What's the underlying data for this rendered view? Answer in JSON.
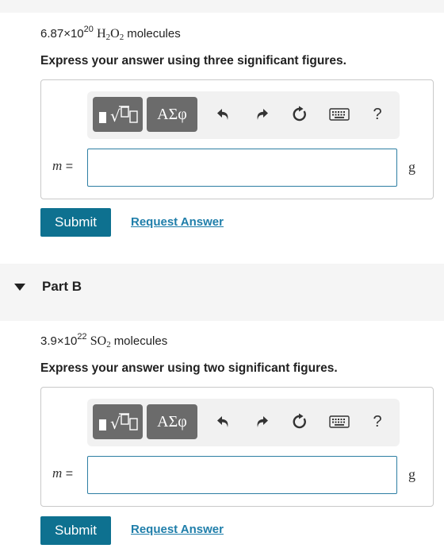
{
  "part_a": {
    "coefficient": "6.87",
    "times": "×",
    "base": "10",
    "exponent": "20",
    "formula": [
      {
        "text": "H",
        "sub": "2"
      },
      {
        "text": "O",
        "sub": "2"
      }
    ],
    "unit_word": "molecules",
    "instruction": "Express your answer using three significant figures.",
    "variable": "m",
    "equals": "=",
    "answer_value": "",
    "unit": "g",
    "submit_label": "Submit",
    "request_label": "Request Answer"
  },
  "part_b_header": {
    "title": "Part B"
  },
  "part_b": {
    "coefficient": "3.9",
    "times": "×",
    "base": "10",
    "exponent": "22",
    "formula": [
      {
        "text": "SO",
        "sub": "2"
      }
    ],
    "unit_word": "molecules",
    "instruction": "Express your answer using two significant figures.",
    "variable": "m",
    "equals": "=",
    "answer_value": "",
    "unit": "g",
    "submit_label": "Submit",
    "request_label": "Request Answer"
  },
  "toolbar": {
    "greek_label": "ΑΣφ",
    "help_label": "?",
    "icons": [
      "templates-icon",
      "greek-symbols-icon",
      "undo-icon",
      "redo-icon",
      "reset-icon",
      "keyboard-icon",
      "help-icon"
    ]
  },
  "colors": {
    "submit_bg": "#0e7190",
    "link": "#1f7eaa",
    "input_border": "#2d7ea3",
    "toolbar_button": "#6b6b6b",
    "part_header_bg": "#f5f5f5"
  }
}
